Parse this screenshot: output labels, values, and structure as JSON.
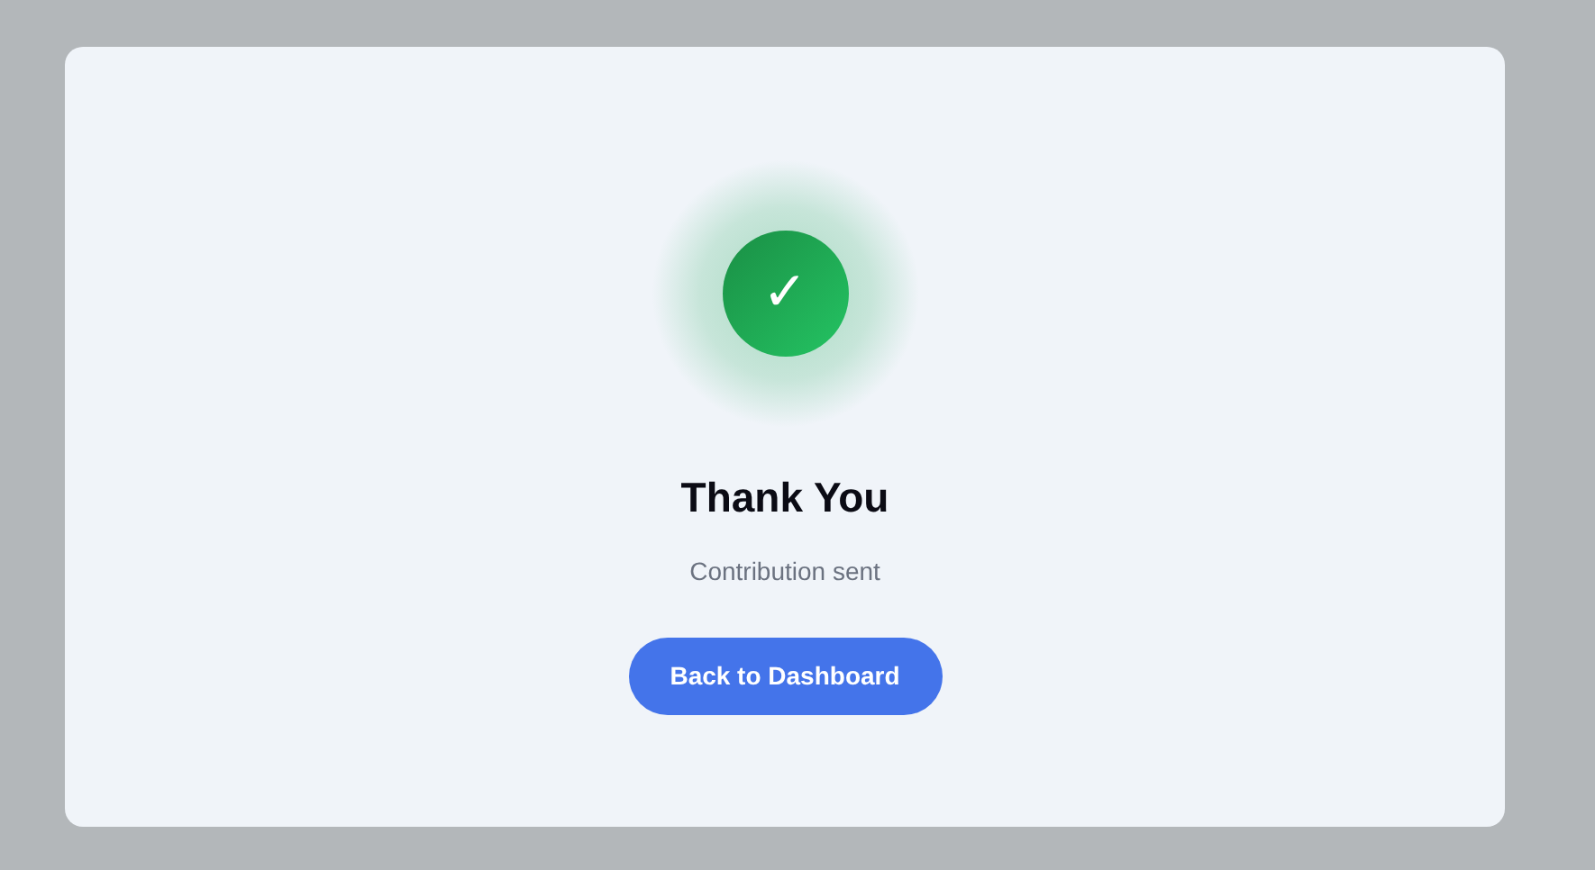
{
  "dialog": {
    "icon_glyph": "✓",
    "title": "Thank You",
    "message": "Contribution sent",
    "button": "Back to Dashboard"
  }
}
